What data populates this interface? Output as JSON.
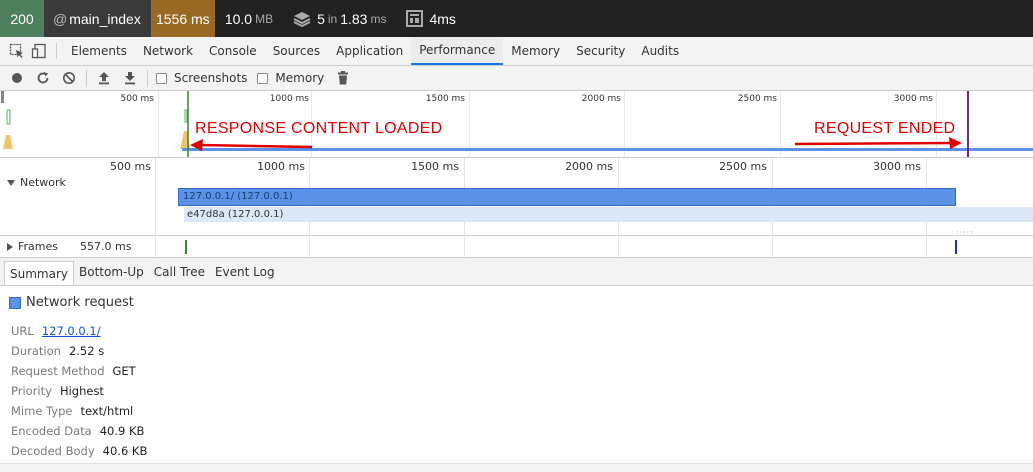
{
  "debugbar": {
    "status": "200",
    "route_prefix": "@",
    "route": "main_index",
    "time": "1556 ms",
    "memory_value": "10.0",
    "memory_unit": "MB",
    "queries_count": "5",
    "queries_in": "in",
    "queries_time": "1.83",
    "queries_unit": "ms",
    "templates_value": "4",
    "templates_unit": "ms",
    "colors": {
      "status_bg": "#4f805d",
      "time_bg": "#9b6a22",
      "bar_bg": "#222222"
    }
  },
  "devtools": {
    "tabs": [
      "Elements",
      "Network",
      "Console",
      "Sources",
      "Application",
      "Performance",
      "Memory",
      "Security",
      "Audits"
    ],
    "active_tab": "Performance",
    "icons": [
      "inspect-element-icon",
      "device-toolbar-icon"
    ]
  },
  "perf_toolbar": {
    "icons": [
      "record-icon",
      "reload-icon",
      "clear-icon",
      "load-profile-icon",
      "save-profile-icon",
      "trash-icon"
    ],
    "screenshots_label": "Screenshots",
    "memory_label": "Memory",
    "screenshots_checked": false,
    "memory_checked": false
  },
  "overview": {
    "ticks": [
      "500 ms",
      "1000 ms",
      "1500 ms",
      "2000 ms",
      "2500 ms",
      "3000 ms"
    ]
  },
  "timeline": {
    "ticks": [
      "500 ms",
      "1000 ms",
      "1500 ms",
      "2000 ms",
      "2500 ms",
      "3000 ms"
    ],
    "network_label": "Network",
    "request_main": "127.0.0.1/ (127.0.0.1)",
    "request_sub": "e47d8a (127.0.0.1)",
    "frames_label": "Frames",
    "frames_value": "557.0 ms"
  },
  "annotations": {
    "left": "RESPONSE CONTENT LOADED",
    "right": "REQUEST ENDED",
    "color": "#e10000"
  },
  "summary": {
    "tabs": [
      "Summary",
      "Bottom-Up",
      "Call Tree",
      "Event Log"
    ],
    "active_tab": "Summary",
    "title": "Network request",
    "rows": [
      {
        "key": "URL",
        "value": "127.0.0.1/"
      },
      {
        "key": "Duration",
        "value": "2.52 s"
      },
      {
        "key": "Request Method",
        "value": "GET"
      },
      {
        "key": "Priority",
        "value": "Highest"
      },
      {
        "key": "Mime Type",
        "value": "text/html"
      },
      {
        "key": "Encoded Data",
        "value": "40.9 KB"
      },
      {
        "key": "Decoded Body",
        "value": "40.6 KB"
      }
    ]
  }
}
